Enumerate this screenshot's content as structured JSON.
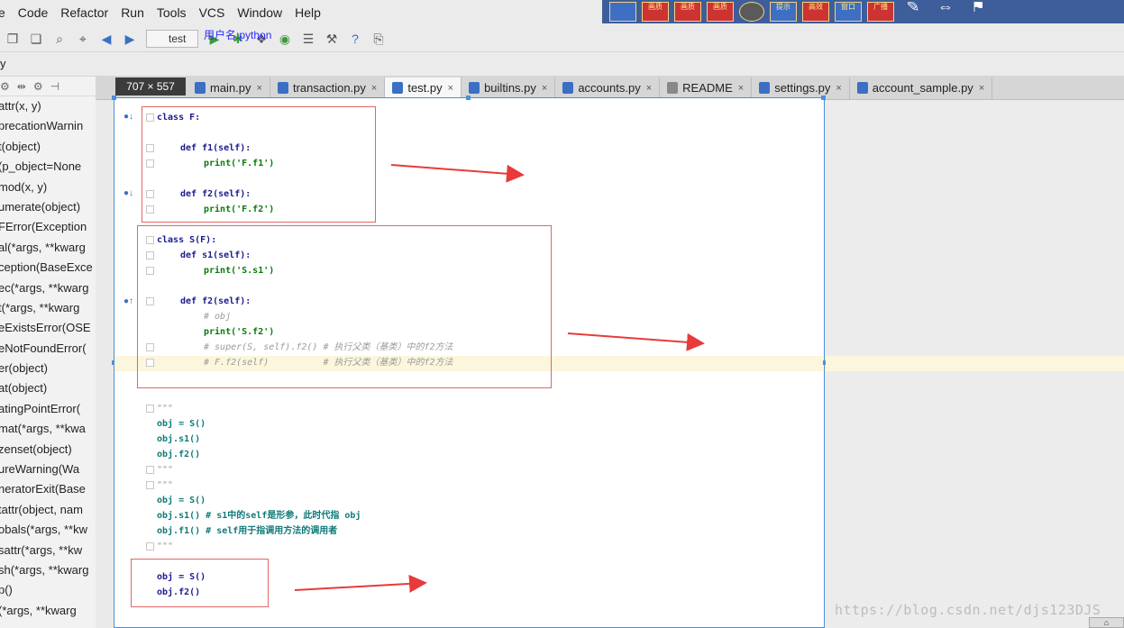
{
  "menu": [
    "e",
    "Code",
    "Refactor",
    "Run",
    "Tools",
    "VCS",
    "Window",
    "Help"
  ],
  "recorder": {
    "buttons": [
      "画质",
      "画质",
      "画质",
      "画质",
      "",
      "提示",
      "高效",
      "窗口",
      "广播",
      "",
      "",
      ""
    ]
  },
  "toolbar": {
    "run_config": "test",
    "username": "用户名:python"
  },
  "breadcrumb": "y",
  "dimensions_badge": "707 × 557",
  "structure": {
    "items": [
      "attr(x, y)",
      "precationWarnin",
      "t(object)",
      "(p_object=None",
      "mod(x, y)",
      "umerate(object)",
      "FError(Exception",
      "al(*args, **kwarg",
      "ception(BaseExce",
      "ec(*args, **kwarg",
      "t(*args, **kwarg",
      "eExistsError(OSE",
      "eNotFoundError(",
      "er(object)",
      "at(object)",
      "atingPointError(",
      "mat(*args, **kwa",
      "zenset(object)",
      "ureWarning(Wa",
      "neratorExit(Base",
      "tattr(object, nam",
      "obals(*args, **kw",
      "sattr(*args, **kw",
      "sh(*args, **kwarg",
      "p()",
      "(*args, **kwarg"
    ]
  },
  "tabs": [
    {
      "label": "main.py",
      "active": false,
      "kind": "py"
    },
    {
      "label": "transaction.py",
      "active": false,
      "kind": "py"
    },
    {
      "label": "test.py",
      "active": true,
      "kind": "py"
    },
    {
      "label": "builtins.py",
      "active": false,
      "kind": "py"
    },
    {
      "label": "accounts.py",
      "active": false,
      "kind": "py"
    },
    {
      "label": "README",
      "active": false,
      "kind": "txt"
    },
    {
      "label": "settings.py",
      "active": false,
      "kind": "py"
    },
    {
      "label": "account_sample.py",
      "active": false,
      "kind": "py"
    }
  ],
  "code": {
    "l1": "class F:",
    "l2": "def f1(self):",
    "l3": "print('F.f1')",
    "l4": "def f2(self):",
    "l5": "print('F.f2')",
    "l6": "class S(F):",
    "l7": "def s1(self):",
    "l8": "print('S.s1')",
    "l9": "def f2(self):",
    "l10": "# obj",
    "l11": "print('S.f2')",
    "l12": "# super(S, self).f2() # 执行父类（基类）中的f2方法",
    "l13": "# F.f2(self)          # 执行父类（基类）中的f2方法",
    "l14": "\"\"\"",
    "l15": "obj = S()",
    "l16": "obj.s1()",
    "l17": "obj.f2()",
    "l18": "\"\"\"",
    "l19": "\"\"\"",
    "l20": "obj = S()",
    "l21": "obj.s1() # s1中的self是形参，此时代指 obj",
    "l22": "obj.f1() # self用于指调用方法的调用者",
    "l23": "\"\"\"",
    "l24": "obj = S()",
    "l25": "obj.f2()"
  },
  "watermark": "https://blog.csdn.net/djs123DJS",
  "colors": {
    "annotation": "#e06666",
    "arrow": "#e83a3a",
    "selection": "#4a90d9"
  }
}
